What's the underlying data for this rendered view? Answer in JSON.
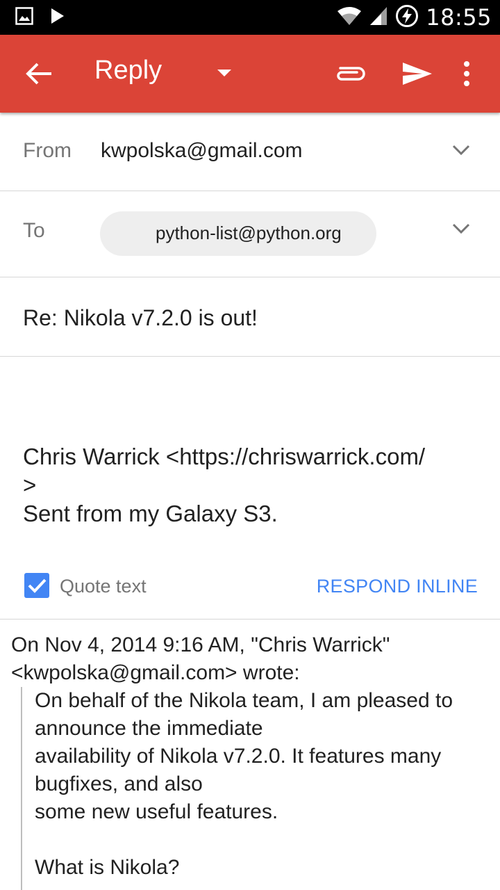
{
  "status_bar": {
    "time": "18:55",
    "icons": [
      "image-notification-icon",
      "play-store-icon",
      "wifi-icon",
      "cell-signal-icon",
      "battery-charging-icon"
    ]
  },
  "app_bar": {
    "title": "Reply",
    "background": "#db4437",
    "icons": [
      "back-arrow-icon",
      "dropdown-caret-icon",
      "attach-icon",
      "send-icon",
      "more-vert-icon"
    ]
  },
  "compose": {
    "from_label": "From",
    "from_value": "kwpolska@gmail.com",
    "to_label": "To",
    "to_recipient": "python-list@python.org",
    "subject": "Re: Nikola v7.2.0 is out!"
  },
  "signature": {
    "lines": [
      "Chris Warrick <https://chriswarrick.com/",
      ">",
      "Sent from my Galaxy S3."
    ]
  },
  "quote_controls": {
    "quote_text_label": "Quote text",
    "quote_text_checked": true,
    "respond_inline_label": "RESPOND INLINE",
    "accent": "#4285f4"
  },
  "quoted": {
    "attribution_line1": "On Nov 4, 2014 9:16 AM, \"Chris Warrick\"",
    "attribution_line2": "<kwpolska@gmail.com> wrote:",
    "lines": [
      "On behalf of the Nikola team, I am pleased to",
      "announce the immediate",
      "availability of Nikola v7.2.0.  It features many",
      "bugfixes, and also",
      "some new useful features.",
      "",
      "What is Nikola?"
    ]
  }
}
